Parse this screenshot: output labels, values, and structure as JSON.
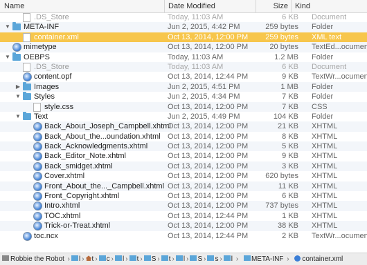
{
  "columns": {
    "name": "Name",
    "date": "Date Modified",
    "size": "Size",
    "kind": "Kind"
  },
  "rows": [
    {
      "name": ".DS_Store",
      "date": "Today, 11:03 AM",
      "size": "6 KB",
      "kind": "Document",
      "depth": 1,
      "icon": "doc",
      "dim": true
    },
    {
      "name": "META-INF",
      "date": "Jun 2, 2015, 4:42 PM",
      "size": "259 bytes",
      "kind": "Folder",
      "depth": 0,
      "icon": "folder",
      "tri": "open"
    },
    {
      "name": "container.xml",
      "date": "Oct 13, 2014, 12:00 PM",
      "size": "259 bytes",
      "kind": "XML text",
      "depth": 1,
      "icon": "doc",
      "selected": true
    },
    {
      "name": "mimetype",
      "date": "Oct 13, 2014, 12:00 PM",
      "size": "20 bytes",
      "kind": "TextEd...ocument",
      "depth": 0,
      "icon": "safari"
    },
    {
      "name": "OEBPS",
      "date": "Today, 11:03 AM",
      "size": "1.2 MB",
      "kind": "Folder",
      "depth": 0,
      "icon": "folder",
      "tri": "open"
    },
    {
      "name": ".DS_Store",
      "date": "Today, 11:03 AM",
      "size": "6 KB",
      "kind": "Document",
      "depth": 1,
      "icon": "doc",
      "dim": true
    },
    {
      "name": "content.opf",
      "date": "Oct 13, 2014, 12:44 PM",
      "size": "9 KB",
      "kind": "TextWr...ocument",
      "depth": 1,
      "icon": "safari"
    },
    {
      "name": "Images",
      "date": "Jun 2, 2015, 4:51 PM",
      "size": "1 MB",
      "kind": "Folder",
      "depth": 1,
      "icon": "folder",
      "tri": "closed"
    },
    {
      "name": "Styles",
      "date": "Jun 2, 2015, 4:34 PM",
      "size": "7 KB",
      "kind": "Folder",
      "depth": 1,
      "icon": "folder",
      "tri": "open"
    },
    {
      "name": "style.css",
      "date": "Oct 13, 2014, 12:00 PM",
      "size": "7 KB",
      "kind": "CSS",
      "depth": 2,
      "icon": "doc"
    },
    {
      "name": "Text",
      "date": "Jun 2, 2015, 4:49 PM",
      "size": "104 KB",
      "kind": "Folder",
      "depth": 1,
      "icon": "folder",
      "tri": "open"
    },
    {
      "name": "Back_About_Joseph_Campbell.xhtml",
      "date": "Oct 13, 2014, 12:00 PM",
      "size": "21 KB",
      "kind": "XHTML",
      "depth": 2,
      "icon": "safari"
    },
    {
      "name": "Back_About_the...oundation.xhtml",
      "date": "Oct 13, 2014, 12:00 PM",
      "size": "8 KB",
      "kind": "XHTML",
      "depth": 2,
      "icon": "safari"
    },
    {
      "name": "Back_Acknowledgments.xhtml",
      "date": "Oct 13, 2014, 12:00 PM",
      "size": "5 KB",
      "kind": "XHTML",
      "depth": 2,
      "icon": "safari"
    },
    {
      "name": "Back_Editor_Note.xhtml",
      "date": "Oct 13, 2014, 12:00 PM",
      "size": "9 KB",
      "kind": "XHTML",
      "depth": 2,
      "icon": "safari"
    },
    {
      "name": "Back_smidget.xhtml",
      "date": "Oct 13, 2014, 12:00 PM",
      "size": "3 KB",
      "kind": "XHTML",
      "depth": 2,
      "icon": "safari"
    },
    {
      "name": "Cover.xhtml",
      "date": "Oct 13, 2014, 12:00 PM",
      "size": "620 bytes",
      "kind": "XHTML",
      "depth": 2,
      "icon": "safari"
    },
    {
      "name": "Front_About_the..._Campbell.xhtml",
      "date": "Oct 13, 2014, 12:00 PM",
      "size": "11 KB",
      "kind": "XHTML",
      "depth": 2,
      "icon": "safari"
    },
    {
      "name": "Front_Copyright.xhtml",
      "date": "Oct 13, 2014, 12:00 PM",
      "size": "6 KB",
      "kind": "XHTML",
      "depth": 2,
      "icon": "safari"
    },
    {
      "name": "Intro.xhtml",
      "date": "Oct 13, 2014, 12:00 PM",
      "size": "737 bytes",
      "kind": "XHTML",
      "depth": 2,
      "icon": "safari"
    },
    {
      "name": "TOC.xhtml",
      "date": "Oct 13, 2014, 12:44 PM",
      "size": "1 KB",
      "kind": "XHTML",
      "depth": 2,
      "icon": "safari"
    },
    {
      "name": "Trick-or-Treat.xhtml",
      "date": "Oct 13, 2014, 12:00 PM",
      "size": "38 KB",
      "kind": "XHTML",
      "depth": 2,
      "icon": "safari"
    },
    {
      "name": "toc.ncx",
      "date": "Oct 13, 2014, 12:44 PM",
      "size": "2 KB",
      "kind": "TextWr...ocument",
      "depth": 1,
      "icon": "safari"
    }
  ],
  "pathbar": {
    "disk": "Robbie the Robot",
    "mid": [
      "l",
      "t",
      "c",
      "l",
      "t",
      "S",
      "t",
      "l",
      "S",
      "s",
      "l"
    ],
    "folder": "META-INF",
    "file": "container.xml"
  }
}
